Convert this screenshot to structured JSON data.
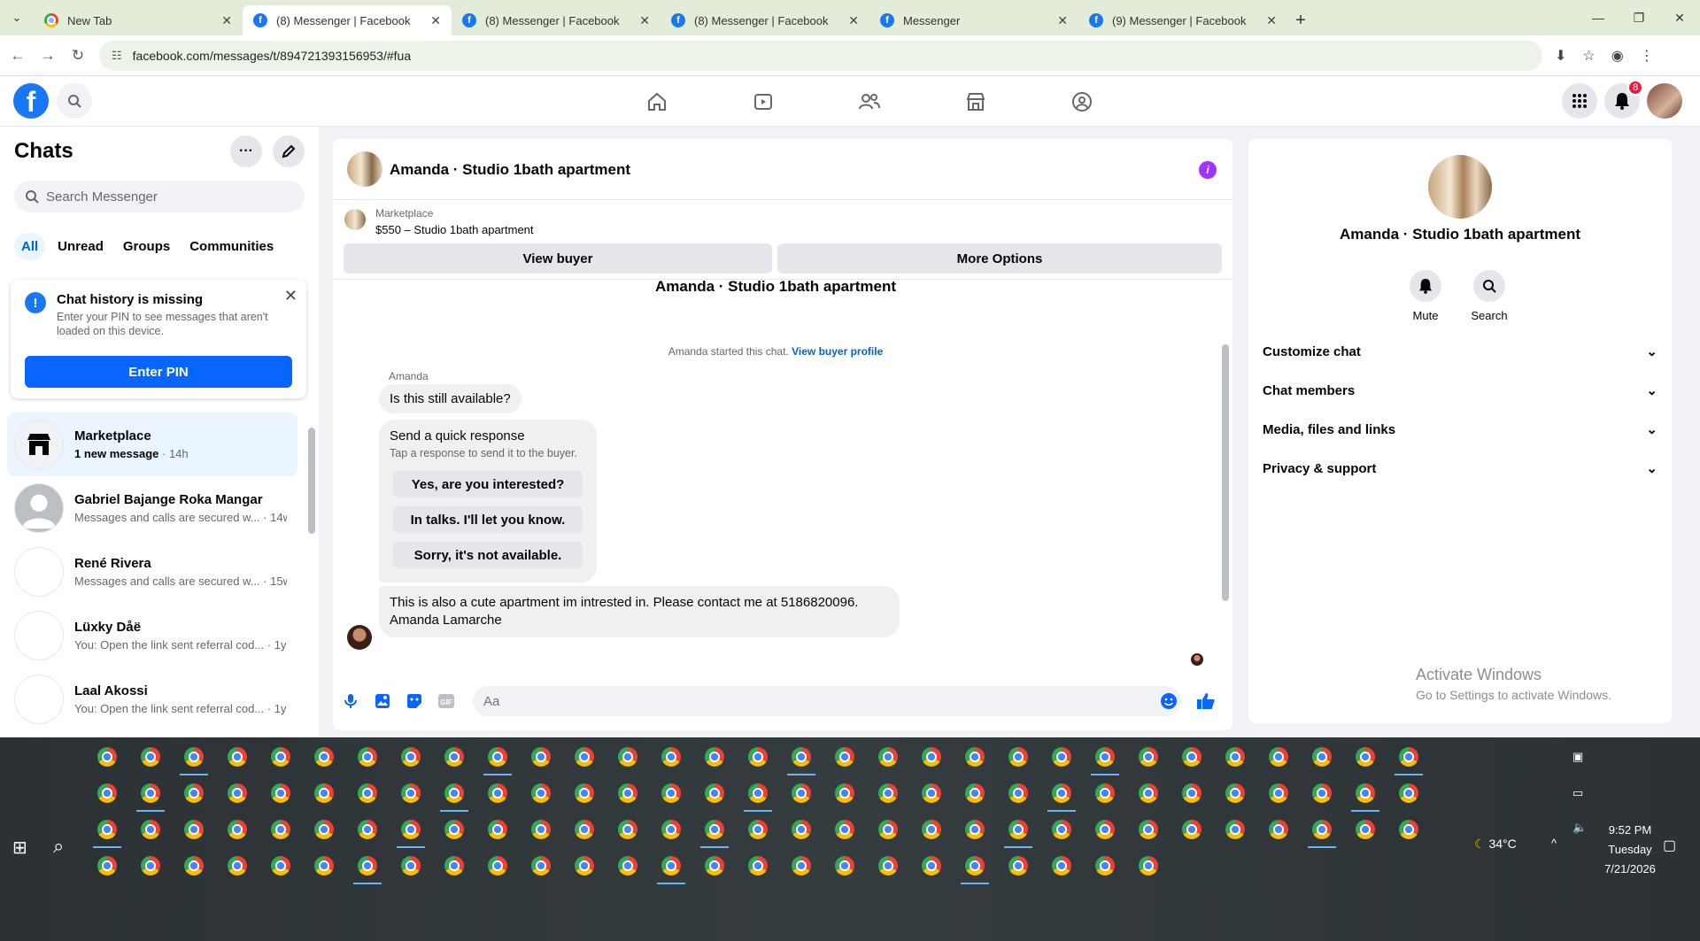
{
  "browser": {
    "tabs": [
      {
        "title": "New Tab",
        "icon": "chrome-icon",
        "active": false
      },
      {
        "title": "(8) Messenger | Facebook",
        "icon": "facebook-icon",
        "active": true
      },
      {
        "title": "(8) Messenger | Facebook",
        "icon": "facebook-icon",
        "active": false
      },
      {
        "title": "(8) Messenger | Facebook",
        "icon": "facebook-icon",
        "active": false
      },
      {
        "title": "Messenger",
        "icon": "facebook-icon",
        "active": false
      },
      {
        "title": "(9) Messenger | Facebook",
        "icon": "facebook-icon",
        "active": false
      }
    ],
    "url": "facebook.com/messages/t/894721393156953/#fua"
  },
  "header": {
    "notification_count": "8",
    "nav_icons": [
      "home-icon",
      "video-icon",
      "friends-icon",
      "marketplace-icon",
      "groups-icon"
    ]
  },
  "sidebar": {
    "title": "Chats",
    "search_placeholder": "Search Messenger",
    "filters": [
      "All",
      "Unread",
      "Groups",
      "Communities"
    ],
    "active_filter": "All",
    "pin_card": {
      "title": "Chat history is missing",
      "desc": "Enter your PIN to see messages that aren't loaded on this device.",
      "button": "Enter PIN"
    },
    "chats": [
      {
        "name": "Marketplace",
        "preview": "1 new message",
        "time": "14h",
        "active": true
      },
      {
        "name": "Gabriel Bajange Roka Mangar",
        "preview": "Messages and calls are secured w...",
        "time": "14w",
        "active": false
      },
      {
        "name": "René Rivera",
        "preview": "Messages and calls are secured w...",
        "time": "15w",
        "active": false
      },
      {
        "name": "Lüxky Dåë",
        "preview": "You: Open the link sent referral cod...",
        "time": "1y",
        "active": false
      },
      {
        "name": "Laal Akossi",
        "preview": "You: Open the link sent referral cod...",
        "time": "1y",
        "active": false
      }
    ]
  },
  "conversation": {
    "title": "Amanda · Studio 1bath apartment",
    "marketplace_label": "Marketplace",
    "listing": "$550 – Studio 1bath apartment",
    "view_buyer": "View buyer",
    "more_options": "More Options",
    "started_text": "Amanda started this chat.",
    "view_buyer_profile": "View buyer profile",
    "sender": "Amanda",
    "first_message": "Is this still available?",
    "quick_response": {
      "title": "Send a quick response",
      "subtitle": "Tap a response to send it to the buyer.",
      "options": [
        "Yes, are you interested?",
        "In talks. I'll let you know.",
        "Sorry, it's not available."
      ]
    },
    "last_message_line1": "This is also a cute apartment im intrested in. Please contact me at 5186820096.",
    "last_message_line2": "Amanda Lamarche",
    "composer_placeholder": "Aa"
  },
  "details": {
    "name": "Amanda · Studio 1bath apartment",
    "actions": [
      "Mute",
      "Search"
    ],
    "sections": [
      "Customize chat",
      "Chat members",
      "Media, files and links",
      "Privacy & support"
    ]
  },
  "watermark": {
    "line1": "Activate Windows",
    "line2": "Go to Settings to activate Windows."
  },
  "taskbar": {
    "weather": "34°C",
    "time": "9:52 PM",
    "day": "Tuesday",
    "date": "7/21/2026"
  },
  "colors": {
    "accent": "#0866ff",
    "tabbar": "#e2ecd9",
    "badge": "#e41e3f",
    "info": "#a033ff"
  }
}
